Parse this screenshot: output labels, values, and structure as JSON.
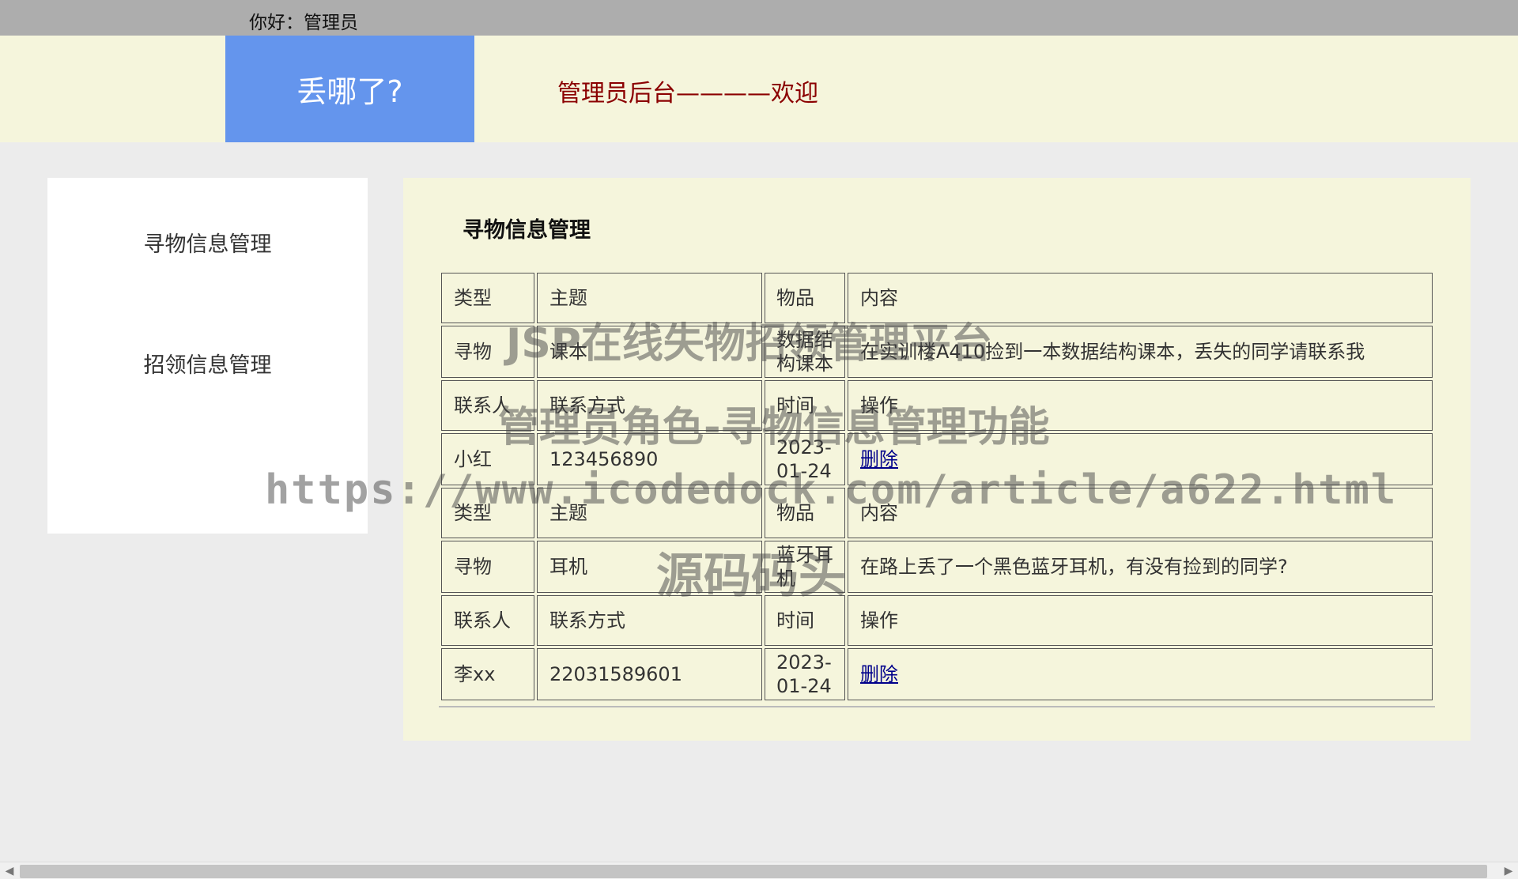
{
  "topbar": {
    "greeting": "你好：管理员"
  },
  "header": {
    "logo_text": "丢哪了?",
    "welcome_text": "管理员后台————欢迎"
  },
  "sidebar": {
    "items": [
      {
        "label": "寻物信息管理"
      },
      {
        "label": "招领信息管理"
      }
    ]
  },
  "main": {
    "title": "寻物信息管理",
    "labels": {
      "type": "类型",
      "subject": "主题",
      "item": "物品",
      "content": "内容",
      "contact": "联系人",
      "phone": "联系方式",
      "time": "时间",
      "action": "操作"
    },
    "delete_label": "删除",
    "records": [
      {
        "type": "寻物",
        "subject": "课本",
        "item": "数据结构课本",
        "content": "在实训楼A410捡到一本数据结构课本，丢失的同学请联系我",
        "contact": "小红",
        "phone": "123456890",
        "time": "2023-01-24"
      },
      {
        "type": "寻物",
        "subject": "耳机",
        "item": "蓝牙耳机",
        "content": "在路上丢了一个黑色蓝牙耳机，有没有捡到的同学?",
        "contact": "李xx",
        "phone": "22031589601",
        "time": "2023-01-24"
      }
    ]
  },
  "watermarks": {
    "line1": "JSP在线失物招领管理平台",
    "line2": "管理员角色-寻物信息管理功能",
    "line3": "https://www.icodedock.com/article/a622.html",
    "line4": "源码码头"
  },
  "icons": {
    "scroll_left": "chevron-left-icon",
    "scroll_right": "chevron-right-icon"
  }
}
